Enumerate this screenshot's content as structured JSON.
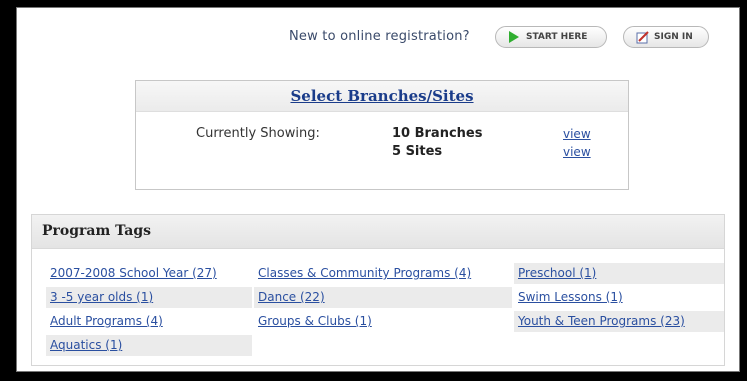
{
  "header": {
    "prompt": "New to online registration?",
    "start_label": "START HERE",
    "signin_label": "SIGN IN",
    "start_icon": "play-icon",
    "signin_icon": "edit-icon"
  },
  "branches": {
    "title": "Select Branches/Sites",
    "currently_label": "Currently Showing:",
    "branches_count": "10 Branches",
    "sites_count": "5 Sites",
    "view_label_1": "view",
    "view_label_2": "view"
  },
  "program_tags": {
    "title": "Program Tags",
    "items": [
      "2007-2008 School Year (27)",
      "3 -5 year olds (1)",
      "Adult Programs (4)",
      "Aquatics (1)",
      "Classes & Community Programs (4)",
      "Dance (22)",
      "Groups & Clubs (1)",
      "Preschool (1)",
      "Swim Lessons (1)",
      "Youth & Teen Programs (23)"
    ]
  },
  "colors": {
    "link": "#2a4fa0",
    "title_link": "#1a3c8a",
    "start_icon": "#2fae2f",
    "signin_icon": "#c0302a"
  }
}
